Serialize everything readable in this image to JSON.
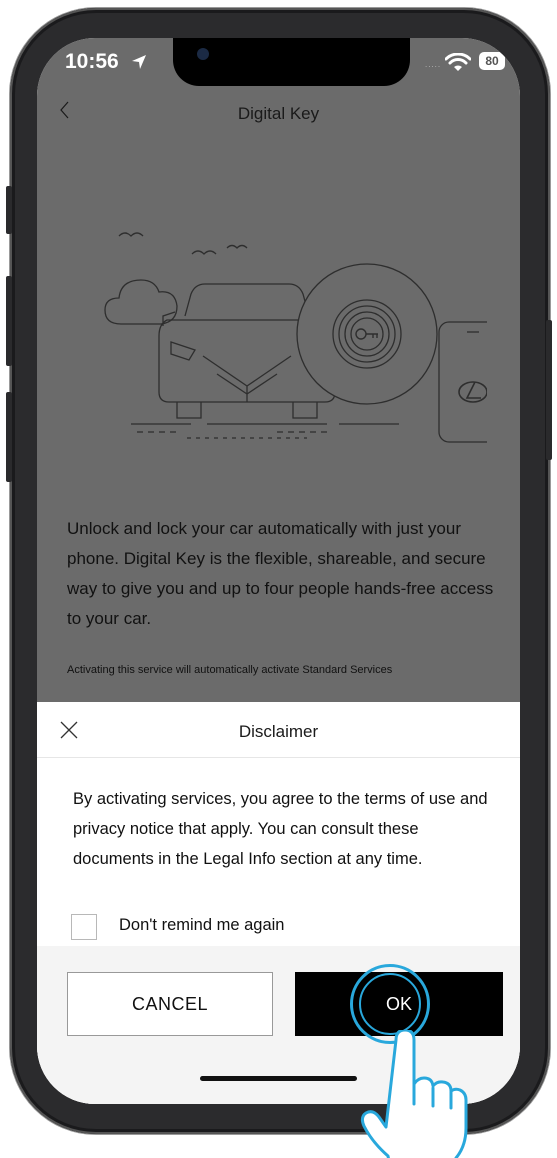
{
  "status": {
    "time": "10:56",
    "battery": "80",
    "signal_dots": "....."
  },
  "header": {
    "title": "Digital Key"
  },
  "main": {
    "description": "Unlock and lock your car automatically with just your phone. Digital Key is the flexible, shareable, and secure way to give you and up to four people hands-free access to your car.",
    "note": "Activating this service will automatically activate Standard Services"
  },
  "dialog": {
    "title": "Disclaimer",
    "text": "By activating services, you agree to the terms of use and privacy notice that apply. You can consult these documents in the Legal Info section at any time.",
    "checkbox_label": "Don't remind me again",
    "checkbox_checked": false,
    "cancel_label": "CANCEL",
    "ok_label": "OK"
  },
  "colors": {
    "overlay": "#6b6b6b",
    "ok_background": "#000000",
    "highlight_ring": "#29a8dc"
  },
  "icons": [
    "location-arrow-icon",
    "wifi-icon",
    "battery-icon",
    "back-chevron-icon",
    "close-icon",
    "key-icon",
    "lexus-logo-icon",
    "hand-pointer-icon"
  ]
}
